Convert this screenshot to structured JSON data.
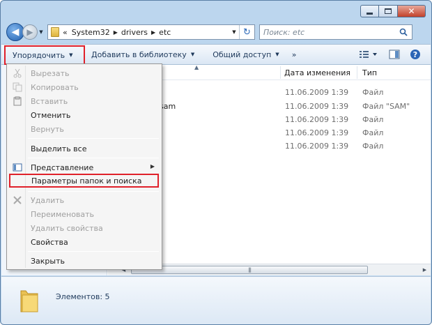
{
  "window": {
    "caption": {
      "minimize_icon": "minimize-icon",
      "maximize_icon": "maximize-icon",
      "close_glyph": "✕"
    }
  },
  "nav": {
    "breadcrumb_prefix": "«",
    "breadcrumbs": [
      "System32",
      "drivers",
      "etc"
    ],
    "search_placeholder": "Поиск: etc"
  },
  "toolbar": {
    "organize": "Упорядочить",
    "add_to_library": "Добавить в библиотеку",
    "share": "Общий доступ",
    "more": "»"
  },
  "columns": {
    "date": "Дата изменения",
    "type": "Тип"
  },
  "files": [
    {
      "name": "",
      "date": "11.06.2009 1:39",
      "type": "Файл"
    },
    {
      "name": "sam",
      "date": "11.06.2009 1:39",
      "type": "Файл \"SAM\""
    },
    {
      "name": "",
      "date": "11.06.2009 1:39",
      "type": "Файл"
    },
    {
      "name": "",
      "date": "11.06.2009 1:39",
      "type": "Файл"
    },
    {
      "name": "",
      "date": "11.06.2009 1:39",
      "type": "Файл"
    }
  ],
  "menu": {
    "cut": "Вырезать",
    "copy": "Копировать",
    "paste": "Вставить",
    "undo": "Отменить",
    "redo": "Вернуть",
    "select_all": "Выделить все",
    "layout": "Представление",
    "folder_options": "Параметры папок и поиска",
    "delete": "Удалить",
    "rename": "Переименовать",
    "remove_properties": "Удалить свойства",
    "properties": "Свойства",
    "close": "Закрыть"
  },
  "status": {
    "items_count": "Элементов: 5"
  },
  "colors": {
    "highlight_border": "#e0202a",
    "toolbar_text": "#1e395b"
  }
}
